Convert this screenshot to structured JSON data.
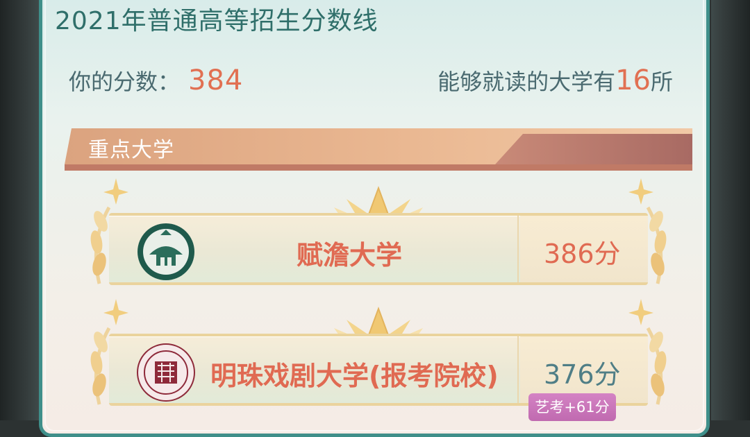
{
  "panel": {
    "title": "2021年普通高等招生分数线",
    "score_label": "你的分数：",
    "score_value": "384",
    "count_prefix": "能够就读的大学有",
    "count_value": "16",
    "count_suffix": "所"
  },
  "section": {
    "label": "重点大学"
  },
  "schools": [
    {
      "name": "赋澹大学",
      "score": "386分",
      "score_color": "#e06a52",
      "logo": "university-seal-green"
    },
    {
      "name": "明珠戏剧大学(报考院校)",
      "score": "376分",
      "score_color": "#4f7e86",
      "badge": "艺考+61分",
      "logo": "university-seal-red"
    }
  ],
  "colors": {
    "accent": "#e17052",
    "title": "#2f6f6a",
    "frame": "#3f8f8a",
    "badge": "#c06ab0"
  }
}
